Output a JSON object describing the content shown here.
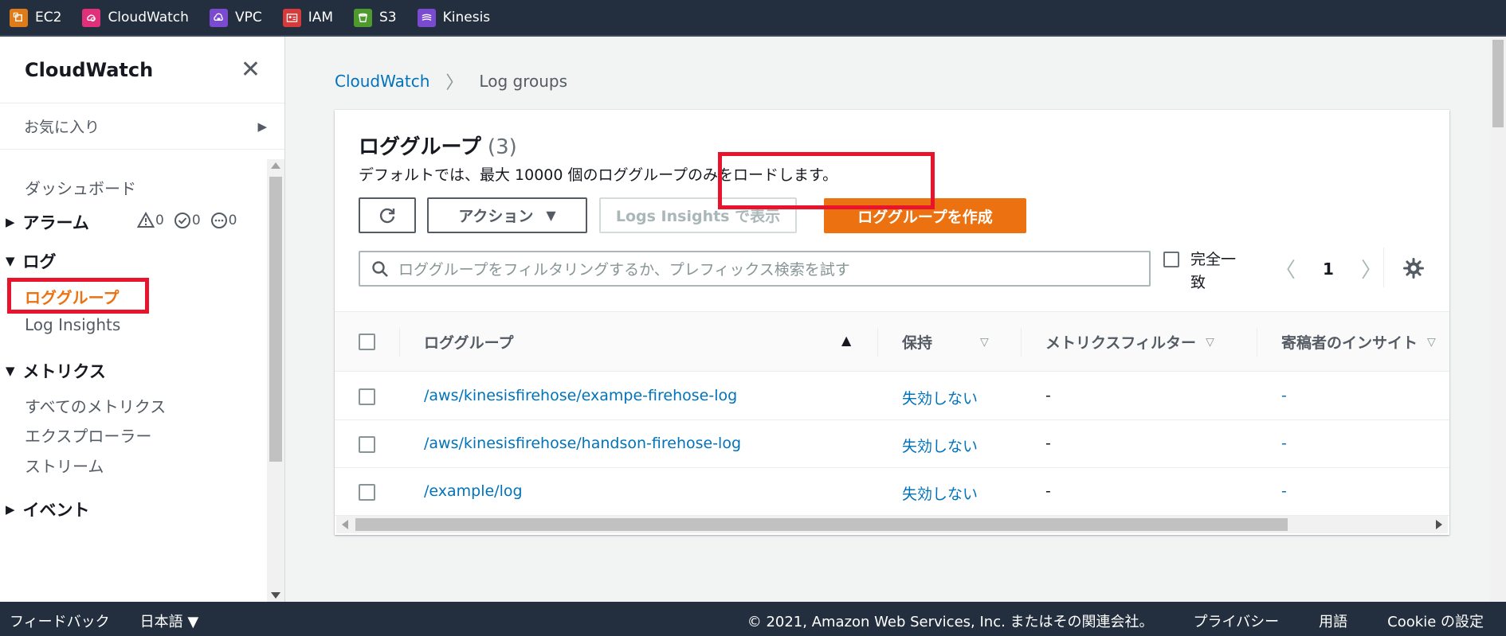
{
  "favorites_bar": [
    {
      "label": "EC2",
      "color": "#e07b1a"
    },
    {
      "label": "CloudWatch",
      "color": "#e0307a"
    },
    {
      "label": "VPC",
      "color": "#7a4ad0"
    },
    {
      "label": "IAM",
      "color": "#d63a3a"
    },
    {
      "label": "S3",
      "color": "#4f9a2e"
    },
    {
      "label": "Kinesis",
      "color": "#7a4ad0"
    }
  ],
  "sidebar": {
    "title": "CloudWatch",
    "favorites_label": "お気に入り",
    "dashboard": "ダッシュボード",
    "alarms": {
      "label": "アラーム",
      "alarm_count": "0",
      "ok_count": "0",
      "insufficient_count": "0"
    },
    "logs": {
      "label": "ログ",
      "items": [
        "ロググループ",
        "Log Insights"
      ]
    },
    "metrics": {
      "label": "メトリクス",
      "items": [
        "すべてのメトリクス",
        "エクスプローラー",
        "ストリーム"
      ]
    },
    "events": {
      "label": "イベント"
    }
  },
  "breadcrumb": {
    "root": "CloudWatch",
    "current": "Log groups"
  },
  "panel": {
    "title": "ロググループ",
    "count": "(3)",
    "description": "デフォルトでは、最大 10000 個のロググループのみをロードします。",
    "action_label": "アクション",
    "insights_label": "Logs Insights で表示",
    "create_label": "ロググループを作成",
    "search_placeholder": "ロググループをフィルタリングするか、プレフィックス検索を試す",
    "exact_match_label": "完全一致",
    "page": "1"
  },
  "table": {
    "columns": [
      "ロググループ",
      "保持",
      "メトリクスフィルター",
      "寄稿者のインサイト"
    ],
    "rows": [
      {
        "name": "/aws/kinesisfirehose/exampe-firehose-log",
        "retention": "失効しない",
        "filters": "-",
        "insights": "-"
      },
      {
        "name": "/aws/kinesisfirehose/handson-firehose-log",
        "retention": "失効しない",
        "filters": "-",
        "insights": "-"
      },
      {
        "name": "/example/log",
        "retention": "失効しない",
        "filters": "-",
        "insights": "-"
      }
    ]
  },
  "footer": {
    "feedback": "フィードバック",
    "language": "日本語 ▼",
    "copyright": "© 2021, Amazon Web Services, Inc. またはその関連会社。",
    "privacy": "プライバシー",
    "terms": "用語",
    "cookie": "Cookie の設定"
  },
  "colors": {
    "accent": "#ec7211",
    "link": "#0073bb",
    "highlight_box": "#e8142e",
    "nav_bg": "#232f3e"
  }
}
